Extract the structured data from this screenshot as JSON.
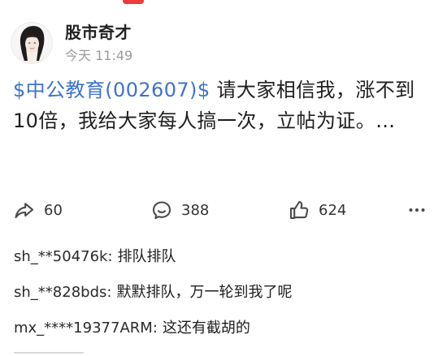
{
  "post": {
    "author": "股市奇才",
    "time": "今天 11:49",
    "stock_tag": "$中公教育(002607)$",
    "body": " 请大家相信我，涨不到10倍，我给大家每人搞一次，立帖为证。…"
  },
  "actions": {
    "share_count": "60",
    "comment_count": "388",
    "like_count": "624"
  },
  "comments": [
    {
      "user": "sh_**50476k",
      "text": "排队排队"
    },
    {
      "user": "sh_**828bds",
      "text": "默默排队，万一轮到我了呢"
    },
    {
      "user": "mx_****19377ARM",
      "text": "这还有截胡的"
    }
  ],
  "icons": {
    "share": "share-icon",
    "comment": "comment-icon",
    "like": "like-icon",
    "more": "more-icon",
    "avatar": "avatar"
  },
  "colors": {
    "stock_tag": "#3e73c9",
    "accent": "#ee3b3b",
    "muted_text": "#9a9a9a"
  }
}
